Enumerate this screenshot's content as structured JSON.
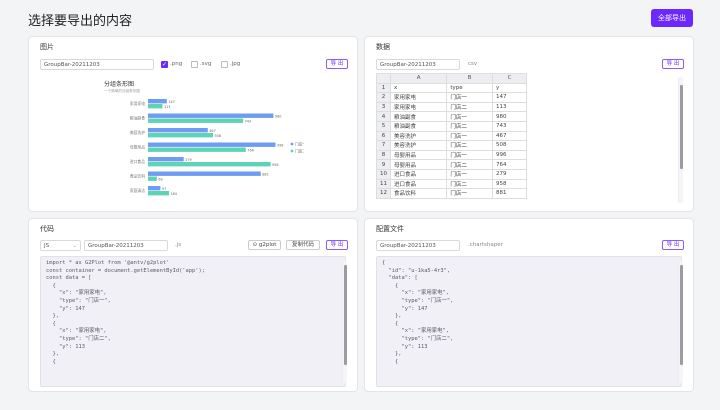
{
  "page": {
    "title": "选择要导出的内容",
    "export_all": "全部导出"
  },
  "image_card": {
    "title": "图片",
    "filename": "GroupBar-20211203",
    "formats": [
      {
        "label": ".png",
        "checked": true
      },
      {
        "label": ".svg",
        "checked": false
      },
      {
        "label": ".jpg",
        "checked": false
      }
    ],
    "export_label": "导 出"
  },
  "data_card": {
    "title": "数据",
    "filename": "GroupBar-20211203",
    "ext": "csv",
    "export_label": "导 出",
    "columns": [
      "A",
      "B",
      "C"
    ],
    "rows": [
      [
        "x",
        "type",
        "y"
      ],
      [
        "家用家电",
        "门店一",
        "147"
      ],
      [
        "家用家电",
        "门店二",
        "113"
      ],
      [
        "粮油副食",
        "门店一",
        "980"
      ],
      [
        "粮油副食",
        "门店二",
        "743"
      ],
      [
        "美容洗护",
        "门店一",
        "467"
      ],
      [
        "美容洗护",
        "门店二",
        "508"
      ],
      [
        "母婴用品",
        "门店一",
        "996"
      ],
      [
        "母婴用品",
        "门店二",
        "764"
      ],
      [
        "进口食品",
        "门店一",
        "279"
      ],
      [
        "进口食品",
        "门店二",
        "958"
      ],
      [
        "食品饮料",
        "门店一",
        "881"
      ]
    ]
  },
  "code_card": {
    "title": "代码",
    "language": "JS",
    "filename": "GroupBar-20211203",
    "ext": ".js",
    "g2plot_label": "g2plot",
    "copy_label": "复制代码",
    "export_label": "导 出",
    "code": "import * as G2Plot from '@antv/g2plot'\nconst container = document.getElementById('app');\nconst data = [\n  {\n    \"x\": \"家用家电\",\n    \"type\": \"门店一\",\n    \"y\": 147\n  },\n  {\n    \"x\": \"家用家电\",\n    \"type\": \"门店二\",\n    \"y\": 113\n  },\n  {"
  },
  "config_card": {
    "title": "配置文件",
    "filename": "GroupBar-20211203",
    "ext": ".chartshaper",
    "export_label": "导 出",
    "code": "{\n  \"id\": \"u-1ka5-4r3\",\n  \"data\": [\n    {\n      \"x\": \"家用家电\",\n      \"type\": \"门店一\",\n      \"y\": 147\n    },\n    {\n      \"x\": \"家用家电\",\n      \"type\": \"门店二\",\n      \"y\": 113\n    },\n    {"
  },
  "chart_data": {
    "type": "bar",
    "orientation": "horizontal",
    "title": "分组条形图",
    "subtitle": "一个简单的分组条形图",
    "categories": [
      "家用家电",
      "粮油副食",
      "美容洗护",
      "母婴用品",
      "进口食品",
      "食品饮料",
      "家庭清洁"
    ],
    "series": [
      {
        "name": "门店一",
        "color": "#6e9cf2",
        "values": [
          147,
          980,
          467,
          996,
          279,
          881,
          97
        ]
      },
      {
        "name": "门店二",
        "color": "#5fd3b5",
        "values": [
          113,
          743,
          508,
          764,
          958,
          69,
          164
        ]
      }
    ],
    "xlim": [
      0,
      1000
    ],
    "legend": "right"
  }
}
